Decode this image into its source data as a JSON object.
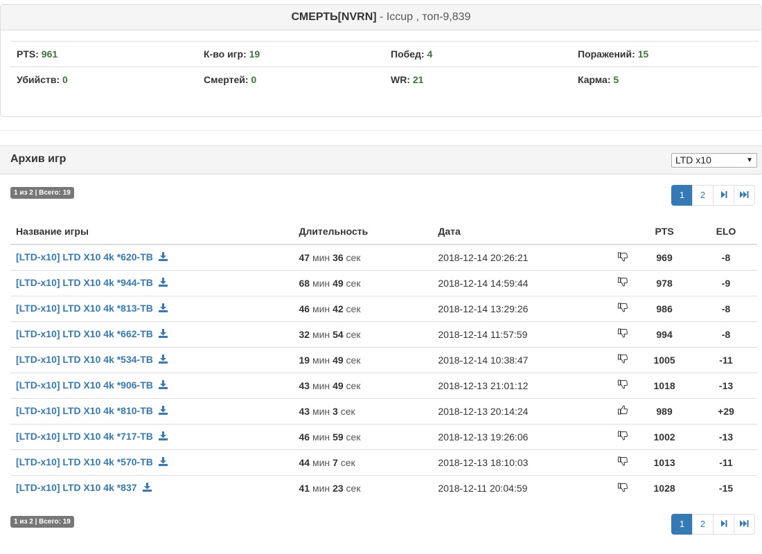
{
  "profile": {
    "name": "СМЕРТЬ[NVRN]",
    "rest": " - Iccup , топ-9,839",
    "stats": [
      [
        {
          "label": "PTS:",
          "value": "961"
        },
        {
          "label": "К-во игр:",
          "value": "19"
        },
        {
          "label": "Побед:",
          "value": "4"
        },
        {
          "label": "Поражений:",
          "value": "15"
        }
      ],
      [
        {
          "label": "Убийств:",
          "value": "0"
        },
        {
          "label": "Смертей:",
          "value": "0"
        },
        {
          "label": "WR:",
          "value": "21"
        },
        {
          "label": "Карма:",
          "value": "5"
        }
      ]
    ]
  },
  "archive": {
    "title": "Архив игр",
    "mode_selected": "LTD x10",
    "badge": "1 из 2 | Всего: 19",
    "pages": [
      "1",
      "2"
    ]
  },
  "table": {
    "headers": {
      "name": "Название игры",
      "duration": "Длительность",
      "date": "Дата",
      "pts": "PTS",
      "elo": "ELO"
    },
    "min_label": "мин",
    "sec_label": "сек",
    "rows": [
      {
        "name": "[LTD-x10] LTD X10 4k *620-TB",
        "min": "47",
        "sec": "36",
        "date": "2018-12-14 20:26:21",
        "result": "thumbs-down",
        "pts": "969",
        "elo": "-8"
      },
      {
        "name": "[LTD-x10] LTD X10 4k *944-TB",
        "min": "68",
        "sec": "49",
        "date": "2018-12-14 14:59:44",
        "result": "thumbs-down",
        "pts": "978",
        "elo": "-9"
      },
      {
        "name": "[LTD-x10] LTD X10 4k *813-TB",
        "min": "46",
        "sec": "42",
        "date": "2018-12-14 13:29:26",
        "result": "thumbs-down",
        "pts": "986",
        "elo": "-8"
      },
      {
        "name": "[LTD-x10] LTD X10 4k *662-TB",
        "min": "32",
        "sec": "54",
        "date": "2018-12-14 11:57:59",
        "result": "thumbs-down",
        "pts": "994",
        "elo": "-8"
      },
      {
        "name": "[LTD-x10] LTD X10 4k *534-TB",
        "min": "19",
        "sec": "49",
        "date": "2018-12-14 10:38:47",
        "result": "thumbs-down",
        "pts": "1005",
        "elo": "-11"
      },
      {
        "name": "[LTD-x10] LTD X10 4k *906-TB",
        "min": "43",
        "sec": "49",
        "date": "2018-12-13 21:01:12",
        "result": "thumbs-down",
        "pts": "1018",
        "elo": "-13"
      },
      {
        "name": "[LTD-x10] LTD X10 4k *810-TB",
        "min": "43",
        "sec": "3",
        "date": "2018-12-13 20:14:24",
        "result": "thumbs-up",
        "pts": "989",
        "elo": "+29"
      },
      {
        "name": "[LTD-x10] LTD X10 4k *717-TB",
        "min": "46",
        "sec": "59",
        "date": "2018-12-13 19:26:06",
        "result": "thumbs-down",
        "pts": "1002",
        "elo": "-13"
      },
      {
        "name": "[LTD-x10] LTD X10 4k *570-TB",
        "min": "44",
        "sec": "7",
        "date": "2018-12-13 18:10:03",
        "result": "thumbs-down",
        "pts": "1013",
        "elo": "-11"
      },
      {
        "name": "[LTD-x10] LTD X10 4k *837",
        "min": "41",
        "sec": "23",
        "date": "2018-12-11 20:04:59",
        "result": "thumbs-down",
        "pts": "1028",
        "elo": "-15"
      }
    ]
  },
  "colors": {
    "link": "#337ab7",
    "value_green": "#3c763d",
    "badge": "#777777"
  }
}
